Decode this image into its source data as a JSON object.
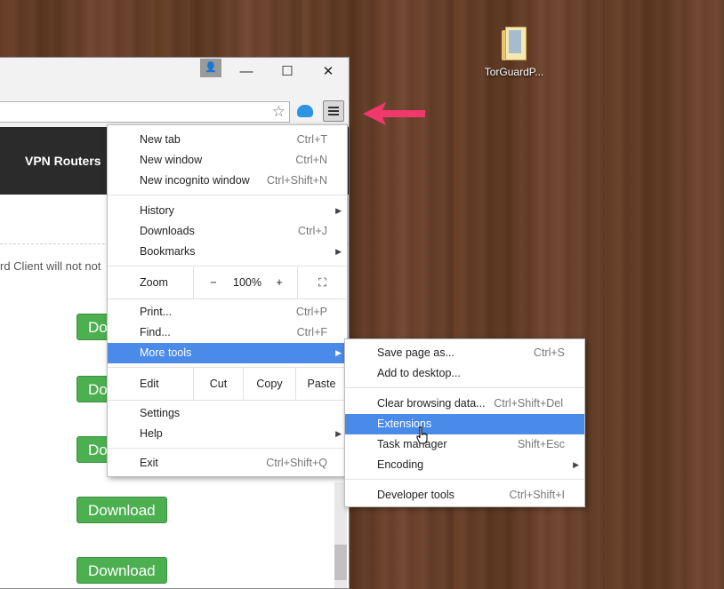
{
  "desktop": {
    "icon_label": "TorGuardP..."
  },
  "browser": {
    "window_buttons": {
      "minimize": "—",
      "maximize": "☐",
      "close": "✕"
    },
    "page": {
      "nav_label": "VPN Routers",
      "notice": "rd Client will not not",
      "download_label": "Download",
      "download_partial": "Do"
    }
  },
  "menu": {
    "new_tab": {
      "label": "New tab",
      "shortcut": "Ctrl+T"
    },
    "new_window": {
      "label": "New window",
      "shortcut": "Ctrl+N"
    },
    "new_incognito": {
      "label": "New incognito window",
      "shortcut": "Ctrl+Shift+N"
    },
    "history": {
      "label": "History"
    },
    "downloads": {
      "label": "Downloads",
      "shortcut": "Ctrl+J"
    },
    "bookmarks": {
      "label": "Bookmarks"
    },
    "zoom": {
      "label": "Zoom",
      "minus": "−",
      "value": "100%",
      "plus": "+"
    },
    "print": {
      "label": "Print...",
      "shortcut": "Ctrl+P"
    },
    "find": {
      "label": "Find...",
      "shortcut": "Ctrl+F"
    },
    "more_tools": {
      "label": "More tools"
    },
    "edit": {
      "label": "Edit",
      "cut": "Cut",
      "copy": "Copy",
      "paste": "Paste"
    },
    "settings": {
      "label": "Settings"
    },
    "help": {
      "label": "Help"
    },
    "exit": {
      "label": "Exit",
      "shortcut": "Ctrl+Shift+Q"
    }
  },
  "submenu": {
    "save_page": {
      "label": "Save page as...",
      "shortcut": "Ctrl+S"
    },
    "add_desktop": {
      "label": "Add to desktop..."
    },
    "clear_data": {
      "label": "Clear browsing data...",
      "shortcut": "Ctrl+Shift+Del"
    },
    "extensions": {
      "label": "Extensions"
    },
    "task_manager": {
      "label": "Task manager",
      "shortcut": "Shift+Esc"
    },
    "encoding": {
      "label": "Encoding"
    },
    "dev_tools": {
      "label": "Developer tools",
      "shortcut": "Ctrl+Shift+I"
    }
  },
  "colors": {
    "highlight": "#4a8ae8",
    "annotation_arrow": "#f0386b",
    "download_green": "#4caf50"
  }
}
